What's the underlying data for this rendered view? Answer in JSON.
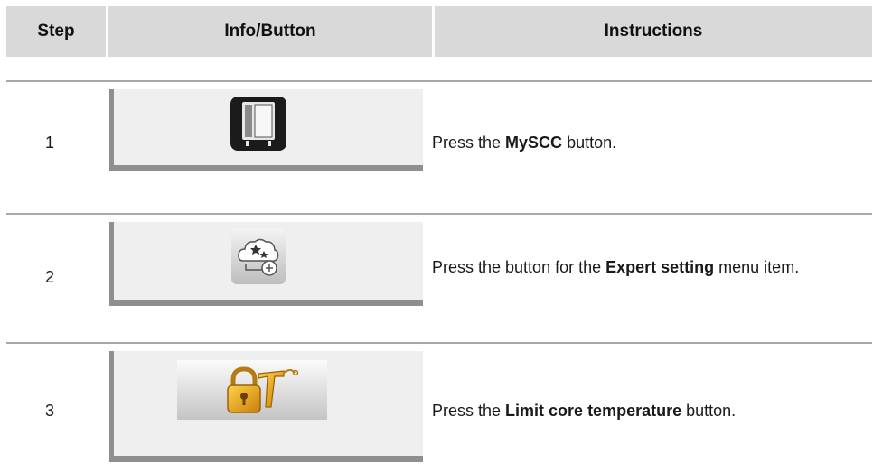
{
  "header": {
    "step": "Step",
    "info": "Info/Button",
    "instructions": "Instructions"
  },
  "rows": [
    {
      "step": "1",
      "icon": "mysccc-oven-icon",
      "pre": "Press the ",
      "bold": "MySCC",
      "post": " button."
    },
    {
      "step": "2",
      "icon": "expert-setting-icon",
      "pre": "Press the button for the ",
      "bold": "Expert setting",
      "post": " menu item."
    },
    {
      "step": "3",
      "icon": "limit-core-temperature-icon",
      "pre": "Press the ",
      "bold": "Limit core temperature",
      "post": " button."
    }
  ],
  "colors": {
    "header_bg": "#d9d9d9",
    "panel_bg": "#efefef",
    "panel_border": "#8f8f8f",
    "rule": "#a8a8a8",
    "lock_gold": "#e8a317"
  }
}
